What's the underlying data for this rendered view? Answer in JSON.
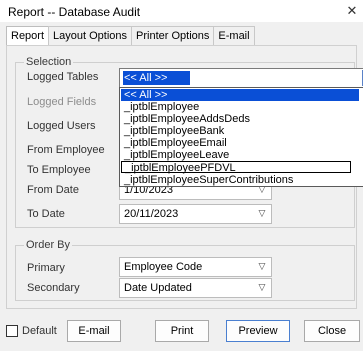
{
  "window": {
    "title": "Report -- Database Audit",
    "close_glyph": "✕"
  },
  "tabs": [
    {
      "label": "Report"
    },
    {
      "label": "Layout Options"
    },
    {
      "label": "Printer Options"
    },
    {
      "label": "E-mail"
    }
  ],
  "selection": {
    "legend": "Selection",
    "logged_tables": {
      "label": "Logged Tables",
      "value": "<< All >>"
    },
    "logged_fields": {
      "label": "Logged Fields"
    },
    "logged_users": {
      "label": "Logged Users"
    },
    "from_employee": {
      "label": "From Employee"
    },
    "to_employee": {
      "label": "To Employee"
    },
    "from_date": {
      "label": "From Date",
      "value": "1/10/2023"
    },
    "to_date": {
      "label": "To Date",
      "value": "20/11/2023"
    }
  },
  "dropdown": {
    "items": [
      "<< All >>",
      "_iptblEmployee",
      "_iptblEmployeeAddsDeds",
      "_iptblEmployeeBank",
      "_iptblEmployeeEmail",
      "_iptblEmployeeLeave",
      "_iptblEmployeePFDVL",
      "_iptblEmployeeSuperContributions"
    ],
    "selected_index": 0,
    "hover_index": 6
  },
  "order_by": {
    "legend": "Order By",
    "primary": {
      "label": "Primary",
      "value": "Employee Code"
    },
    "secondary": {
      "label": "Secondary",
      "value": "Date Updated"
    }
  },
  "footer": {
    "default_label": "Default",
    "default_checked": false,
    "email_button": "E-mail",
    "print_button": "Print",
    "preview_button": "Preview",
    "close_button": "Close"
  },
  "colors": {
    "selection": "#0a4fd6",
    "background": "#f0f0f0",
    "focus_border": "#4a7fd0"
  }
}
